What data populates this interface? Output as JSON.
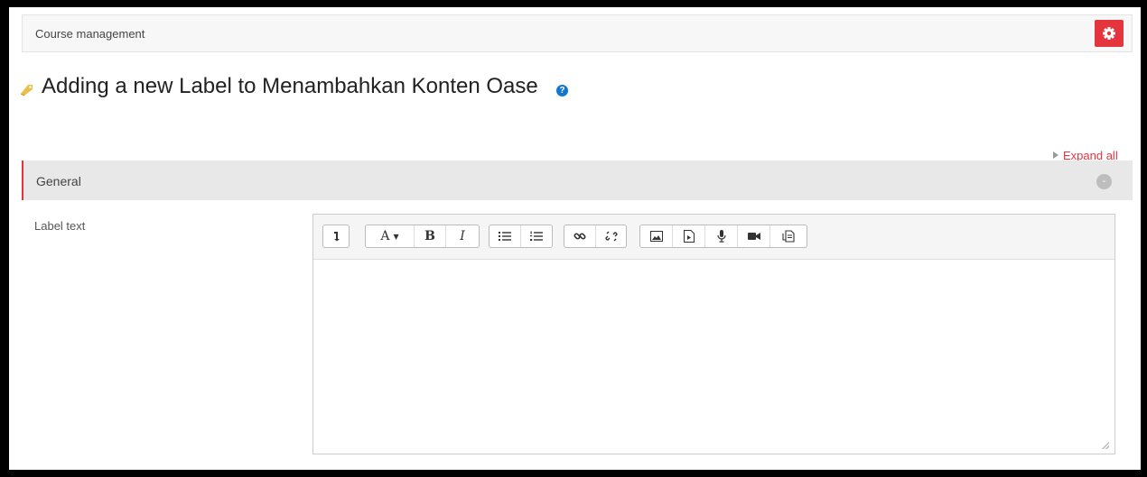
{
  "course_management": {
    "label": "Course management"
  },
  "page": {
    "title": "Adding a new Label to Menambahkan Konten Oase",
    "help_glyph": "?"
  },
  "expand_all": {
    "label": "Expand all"
  },
  "section": {
    "title": "General",
    "collapse_glyph": "-"
  },
  "field": {
    "label": "Label text"
  },
  "toolbar": {
    "font_label": "A",
    "bold": "B",
    "italic": "I"
  },
  "colors": {
    "accent": "#e4353f",
    "help": "#1177d1",
    "section_bg": "#e8e8e8"
  },
  "icons": [
    "gear-icon",
    "tag-icon",
    "help-icon",
    "collapse-icon",
    "show-more-icon",
    "font-style-icon",
    "bold-icon",
    "italic-icon",
    "unordered-list-icon",
    "ordered-list-icon",
    "link-icon",
    "unlink-icon",
    "image-icon",
    "media-icon",
    "record-audio-icon",
    "record-video-icon",
    "manage-files-icon",
    "resize-handle-icon"
  ]
}
